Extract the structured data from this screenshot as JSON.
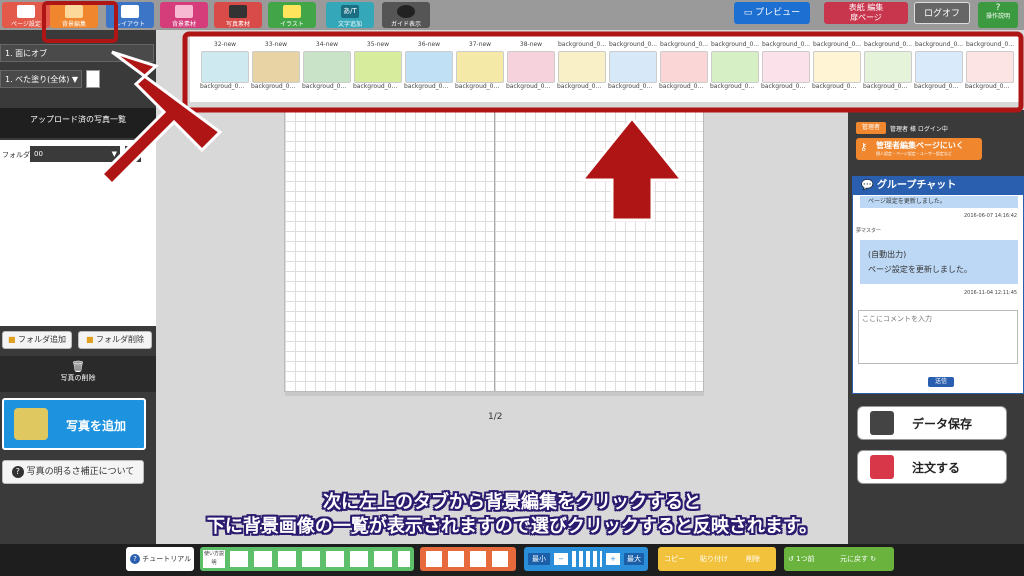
{
  "top_tabs": [
    {
      "label": "ページ設定",
      "color": "#e35a4a"
    },
    {
      "label": "背景編集",
      "color": "#f0872e"
    },
    {
      "label": "レイアウト",
      "color": "#3c74c6"
    },
    {
      "label": "背景素材",
      "color": "#d43c7a"
    },
    {
      "label": "写真素材",
      "color": "#d94b49"
    },
    {
      "label": "イラスト",
      "color": "#42a548"
    },
    {
      "label": "文字追加",
      "color": "#34a7b9"
    },
    {
      "label": "ガイド表示",
      "color": "#555555"
    }
  ],
  "top_right": {
    "preview": "プレビュー",
    "cover_edit_line1": "表紙",
    "cover_edit_line2": "扉ページ",
    "cover_edit_suffix": "編集",
    "logoff": "ログオフ",
    "manual": "操作説明"
  },
  "left": {
    "select1": "1. 面にオブ",
    "select2": "1. べた塗り(全体)",
    "uploaded_title": "アップロード済の写真一覧",
    "folder_label": "フォルダ",
    "folder_value": "00",
    "add_folder": "フォルダ追加",
    "delete_folder": "フォルダ削除",
    "delete_photo": "写真の削除",
    "add_photo": "写真を追加",
    "brightness_help": "写真の明るさ補正について"
  },
  "backgrounds": [
    {
      "label": "32-new",
      "sub": "backgroud_0...",
      "color": "#cfe9f1"
    },
    {
      "label": "33-new",
      "sub": "backgroud_0...",
      "color": "#e8d3a5"
    },
    {
      "label": "34-new",
      "sub": "backgroud_0...",
      "color": "#c8e3c8"
    },
    {
      "label": "35-new",
      "sub": "backgroud_0...",
      "color": "#d8ec9e"
    },
    {
      "label": "36-new",
      "sub": "backgroud_0...",
      "color": "#bfe0f5"
    },
    {
      "label": "37-new",
      "sub": "backgroud_0...",
      "color": "#f5e9a8"
    },
    {
      "label": "38-new",
      "sub": "backgroud_0...",
      "color": "#f6d2dc"
    },
    {
      "label": "background_0...",
      "sub": "backgroud_0...",
      "color": "#faf0c8"
    },
    {
      "label": "background_0...",
      "sub": "backgroud_0...",
      "color": "#d7e9f8"
    },
    {
      "label": "background_0...",
      "sub": "backgroud_0...",
      "color": "#fbd6d6"
    },
    {
      "label": "background_0...",
      "sub": "backgroud_0...",
      "color": "#d6efc4"
    },
    {
      "label": "background_0...",
      "sub": "backgroud_0...",
      "color": "#fbe1ea"
    },
    {
      "label": "background_0...",
      "sub": "backgroud_0...",
      "color": "#fff4d4"
    },
    {
      "label": "background_0...",
      "sub": "backgroud_0...",
      "color": "#e5f3da"
    },
    {
      "label": "background_0...",
      "sub": "backgroud_0...",
      "color": "#d9eafa"
    },
    {
      "label": "background_0...",
      "sub": "backgroud_0...",
      "color": "#fce4e4"
    }
  ],
  "canvas": {
    "page_indicator": "1/2"
  },
  "right": {
    "admin_badge": "管理者",
    "login_status": "管理者 様 ログイン中",
    "admin_edit_button": "管理者編集ページにいく",
    "admin_edit_sub": "個人設定・ページ設定・ユーザー設定など",
    "group_chat_title": "グループチャット",
    "messages": [
      {
        "text": "ページ設定を更新しました。",
        "time": "2016-06-07 14:16:42",
        "sender": ""
      },
      {
        "sender": "夢マスター",
        "text": "(自動出力)",
        "text2": "ページ設定を更新しました。",
        "time": "2016-11-04 12:11:45"
      }
    ],
    "comment_placeholder": "ここにコメントを入力",
    "send": "送信",
    "save_data": "データ保存",
    "order": "注文する"
  },
  "caption": {
    "line1": "次に左上のタブから背景編集をクリックすると",
    "line2": "下に背景画像の一覧が表示されますので選びクリックすると反映されます。"
  },
  "bottom": {
    "tutorial": "チュートリアル",
    "howto": "使い方説明",
    "zoom_min": "最小",
    "zoom_max": "最大",
    "copy": "コピー",
    "paste": "貼り付け",
    "delete": "削除",
    "undo": "1つ前",
    "redo": "元に戻す"
  },
  "colors": {
    "annotation_red": "#b01515",
    "accent_orange": "#f0872e",
    "chat_blue": "#2a5fb0"
  }
}
